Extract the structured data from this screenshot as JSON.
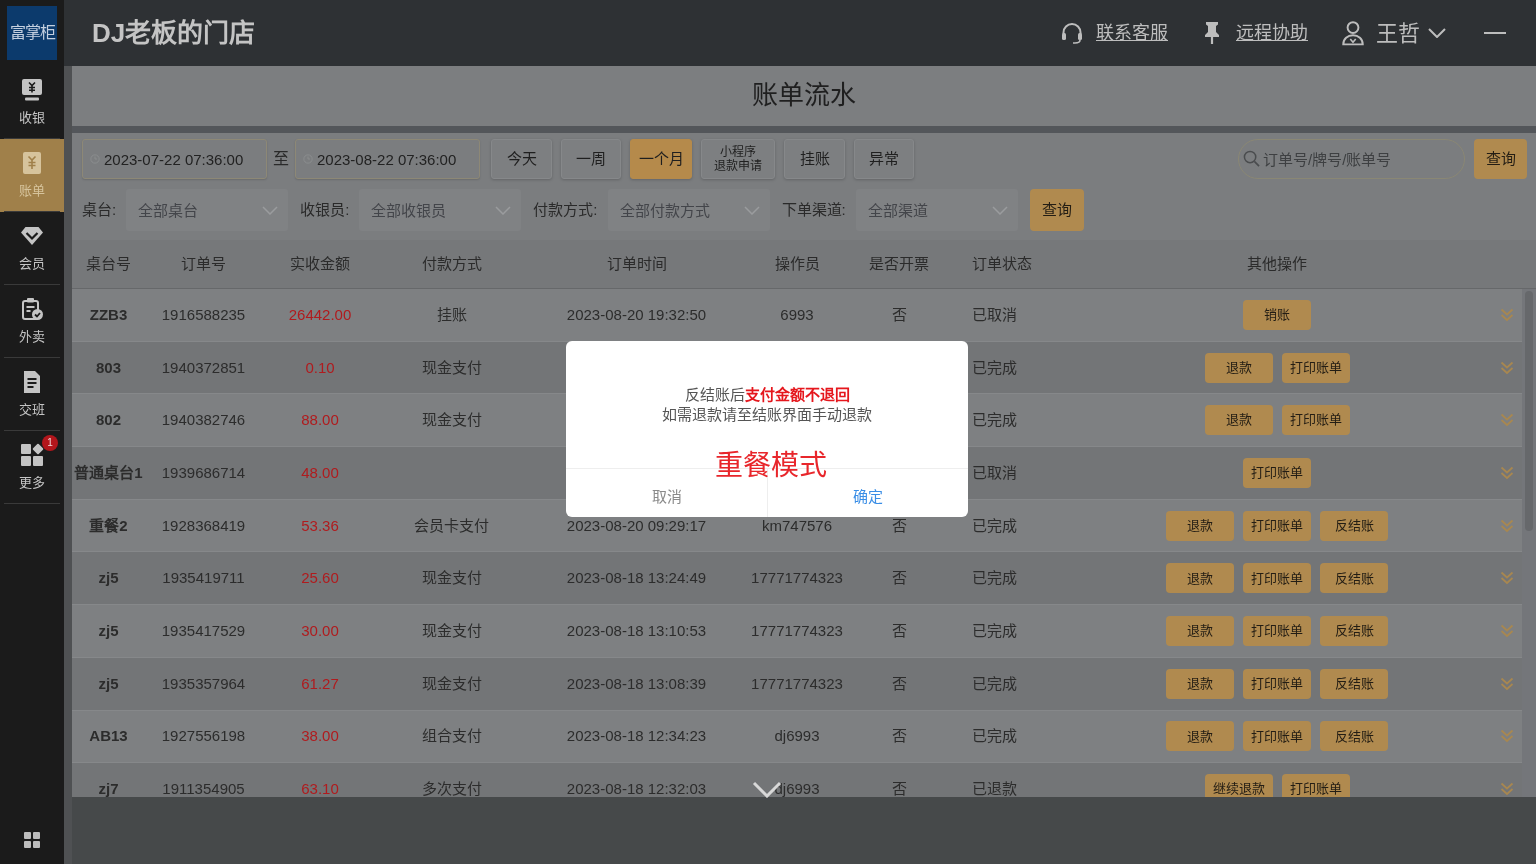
{
  "header": {
    "logo": "富掌柜",
    "store_name": "DJ老板的门店",
    "links": [
      {
        "label": "联系客服",
        "kind": "support"
      },
      {
        "label": "远程协助",
        "kind": "remote"
      }
    ],
    "user": "王哲"
  },
  "sidebar": {
    "items": [
      {
        "label": "收银",
        "kind": "cashier",
        "selected": false
      },
      {
        "label": "账单",
        "kind": "bill",
        "selected": true
      },
      {
        "label": "会员",
        "kind": "member",
        "selected": false
      },
      {
        "label": "外卖",
        "kind": "takeout",
        "selected": false
      },
      {
        "label": "交班",
        "kind": "shift",
        "selected": false
      },
      {
        "label": "更多",
        "kind": "more",
        "selected": false,
        "badge": "1"
      }
    ]
  },
  "page_title": "账单流水",
  "filters": {
    "date_from": "2023-07-22 07:36:00",
    "range_separator": "至",
    "date_to": "2023-08-22 07:36:00",
    "quick_ranges": [
      {
        "label": "今天",
        "kind": "one_line",
        "selected": false
      },
      {
        "label": "一周",
        "kind": "one_line",
        "selected": false
      },
      {
        "label": "一个月",
        "kind": "one_line",
        "selected": true
      },
      {
        "label": "小程序退款申请",
        "kind": "two_line",
        "selected": false
      },
      {
        "label": "挂账",
        "kind": "one_line",
        "selected": false
      },
      {
        "label": "异常",
        "kind": "one_line",
        "selected": false
      }
    ],
    "search": {
      "placeholder": "订单号/牌号/账单号"
    },
    "search_button": "查询",
    "selects": [
      {
        "label": "桌台:",
        "placeholder": "全部桌台"
      },
      {
        "label": "收银员:",
        "placeholder": "全部收银员"
      },
      {
        "label": "付款方式:",
        "placeholder": "全部付款方式"
      },
      {
        "label": "下单渠道:",
        "placeholder": "全部渠道"
      }
    ],
    "query_button": "查询"
  },
  "table": {
    "columns": [
      "桌台号",
      "订单号",
      "实收金额",
      "付款方式",
      "订单时间",
      "操作员",
      "是否开票",
      "订单状态",
      "其他操作"
    ],
    "rows": [
      {
        "table_no": "ZZB3",
        "order_no": "1916588235",
        "amount": "26442.00",
        "payment": "挂账",
        "time": "2023-08-20 19:32:50",
        "operator": "6993",
        "invoice": "否",
        "status": "已取消",
        "actions": [
          "销账"
        ]
      },
      {
        "table_no": "803",
        "order_no": "1940372851",
        "amount": "0.10",
        "payment": "现金支付",
        "status": "已完成",
        "actions": [
          "退款",
          "打印账单"
        ]
      },
      {
        "table_no": "802",
        "order_no": "1940382746",
        "amount": "88.00",
        "payment": "现金支付",
        "status": "已完成",
        "actions": [
          "退款",
          "打印账单"
        ]
      },
      {
        "table_no": "普通桌台1",
        "order_no": "1939686714",
        "amount": "48.00",
        "status": "已取消",
        "actions": [
          "打印账单"
        ]
      },
      {
        "table_no": "重餐2",
        "order_no": "1928368419",
        "amount": "53.36",
        "payment": "会员卡支付",
        "time": "2023-08-20 09:29:17",
        "operator": "km747576",
        "invoice": "否",
        "status": "已完成",
        "actions": [
          "退款",
          "打印账单",
          "反结账"
        ]
      },
      {
        "table_no": "zj5",
        "order_no": "1935419711",
        "amount": "25.60",
        "payment": "现金支付",
        "time": "2023-08-18 13:24:49",
        "operator": "17771774323",
        "invoice": "否",
        "status": "已完成",
        "actions": [
          "退款",
          "打印账单",
          "反结账"
        ]
      },
      {
        "table_no": "zj5",
        "order_no": "1935417529",
        "amount": "30.00",
        "payment": "现金支付",
        "time": "2023-08-18 13:10:53",
        "operator": "17771774323",
        "invoice": "否",
        "status": "已完成",
        "actions": [
          "退款",
          "打印账单",
          "反结账"
        ]
      },
      {
        "table_no": "zj5",
        "order_no": "1935357964",
        "amount": "61.27",
        "payment": "现金支付",
        "time": "2023-08-18 13:08:39",
        "operator": "17771774323",
        "invoice": "否",
        "status": "已完成",
        "actions": [
          "退款",
          "打印账单",
          "反结账"
        ]
      },
      {
        "table_no": "AB13",
        "order_no": "1927556198",
        "amount": "38.00",
        "payment": "组合支付",
        "time": "2023-08-18 12:34:23",
        "operator": "dj6993",
        "invoice": "否",
        "status": "已完成",
        "actions": [
          "退款",
          "打印账单",
          "反结账"
        ]
      },
      {
        "table_no": "zj7",
        "order_no": "1911354905",
        "amount": "63.10",
        "payment": "多次支付",
        "time": "2023-08-18 12:32:03",
        "operator": "dj6993",
        "invoice": "否",
        "status": "已退款",
        "actions": [
          "继续退款",
          "打印账单"
        ]
      }
    ]
  },
  "dialog": {
    "message": "反结账后**支付金额不退回**",
    "note": "如需退款请至结账界面手动退款",
    "mode_label": "重餐模式",
    "buttons": [
      {
        "label": "取消",
        "kind": "cancel"
      },
      {
        "label": "确定",
        "kind": "confirm"
      }
    ]
  }
}
